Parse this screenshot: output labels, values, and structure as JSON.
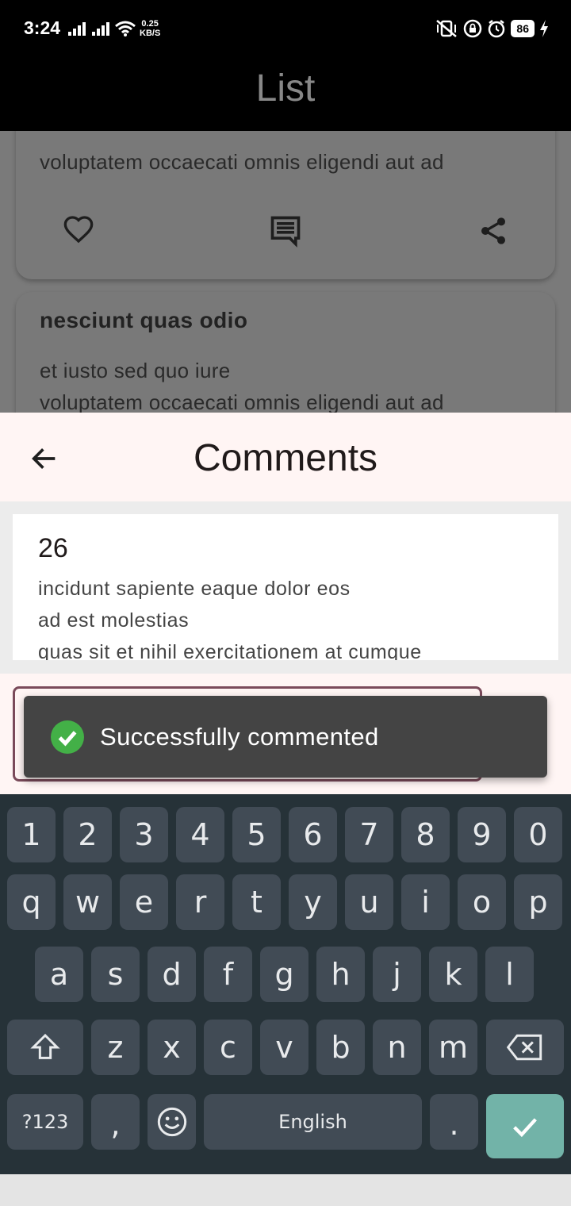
{
  "status_bar": {
    "time": "3:24",
    "net_speed_value": "0.25",
    "net_speed_unit": "KB/S",
    "battery": "86"
  },
  "background_app": {
    "title": "List",
    "card1": {
      "body_line": "voluptatem occaecati omnis eligendi aut ad"
    },
    "card2": {
      "title": "nesciunt quas odio",
      "body_line1": "et iusto sed quo iure",
      "body_line2": "voluptatem occaecati omnis eligendi aut ad"
    }
  },
  "comments_sheet": {
    "title": "Comments",
    "comment": {
      "id": "26",
      "line1": "incidunt sapiente eaque dolor eos",
      "line2": "ad est molestias",
      "line3": "quas sit et nihil exercitationem at cumque"
    },
    "input_value": ""
  },
  "snackbar": {
    "message": "Successfully commented",
    "icon": "check-circle-icon",
    "icon_color": "#43b047"
  },
  "keyboard": {
    "row1": [
      "1",
      "2",
      "3",
      "4",
      "5",
      "6",
      "7",
      "8",
      "9",
      "0"
    ],
    "row2": [
      "q",
      "w",
      "e",
      "r",
      "t",
      "y",
      "u",
      "i",
      "o",
      "p"
    ],
    "row3": [
      "a",
      "s",
      "d",
      "f",
      "g",
      "h",
      "j",
      "k",
      "l"
    ],
    "row4": [
      "z",
      "x",
      "c",
      "v",
      "b",
      "n",
      "m"
    ],
    "symbols_label": "?123",
    "comma_label": ",",
    "space_label": "English",
    "period_label": "."
  },
  "colors": {
    "accent": "#7a4a5a",
    "enter_key": "#72b3a8",
    "sheet_header": "#fff5f4"
  }
}
